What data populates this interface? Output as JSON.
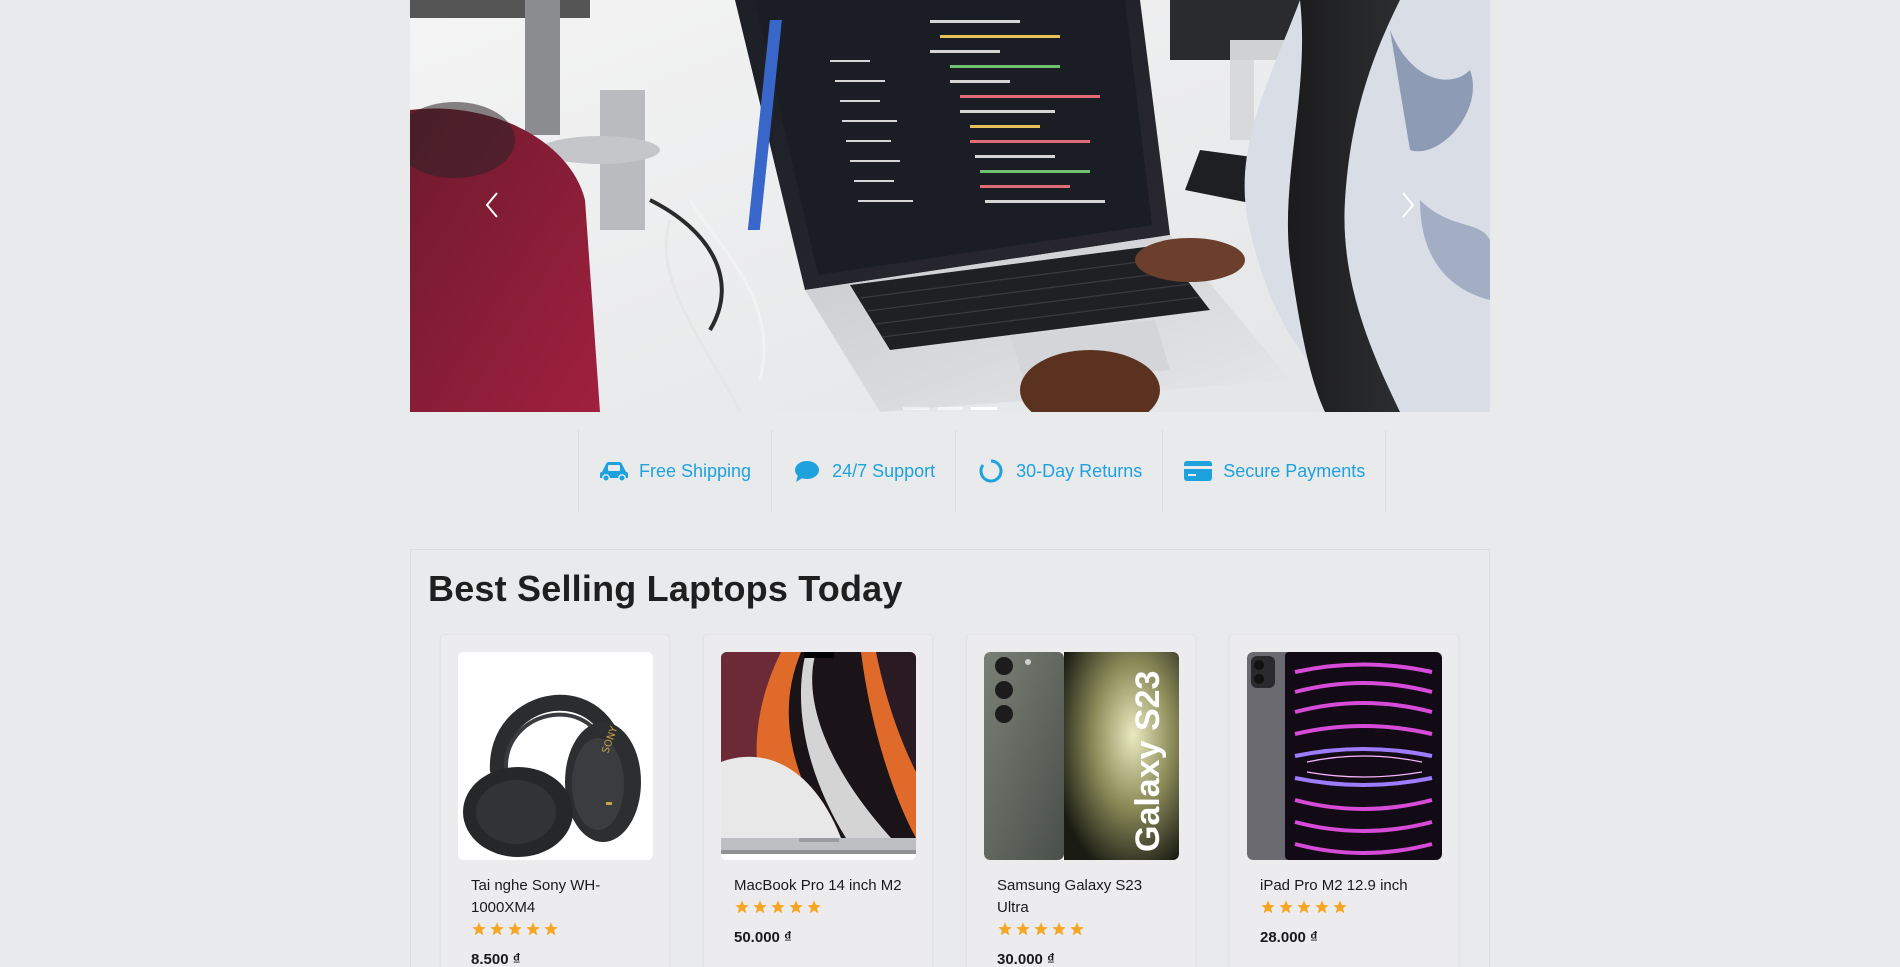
{
  "carousel": {
    "prev_label": "Previous",
    "next_label": "Next",
    "slides": [
      "slide-1",
      "slide-2",
      "slide-3"
    ],
    "active_index": 2
  },
  "features": [
    {
      "icon": "car-icon",
      "label": "Free Shipping"
    },
    {
      "icon": "chat-bubble-icon",
      "label": "24/7 Support"
    },
    {
      "icon": "circle-arrow-icon",
      "label": "30-Day Returns"
    },
    {
      "icon": "credit-card-icon",
      "label": "Secure Payments"
    }
  ],
  "accent_color": "#1ea2de",
  "star_color": "#f5a623",
  "best_selling": {
    "title": "Best Selling Laptops Today",
    "products": [
      {
        "name": "Tai nghe Sony WH-1000XM4",
        "rating": 5,
        "price": "8.500 ₫"
      },
      {
        "name": "MacBook Pro 14 inch M2",
        "rating": 5,
        "price": "50.000 ₫"
      },
      {
        "name": "Samsung Galaxy S23 Ultra",
        "rating": 5,
        "price": "30.000 ₫"
      },
      {
        "name": "iPad Pro M2 12.9 inch",
        "rating": 5,
        "price": "28.000 ₫"
      }
    ]
  },
  "product_image_text": {
    "headphones_brand": "SONY",
    "phone_brand": "Galaxy S23"
  }
}
